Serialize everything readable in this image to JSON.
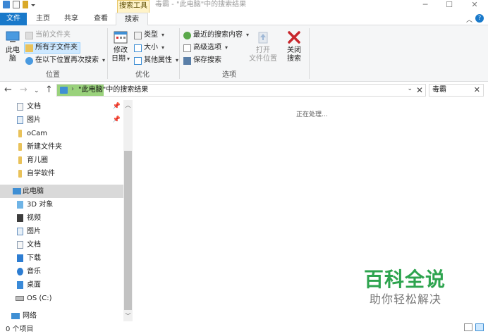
{
  "window": {
    "title": "毒霸 - \"此电脑\"中的搜索结果",
    "context_tab_group": "搜索工具"
  },
  "tabs": [
    {
      "label": "文件"
    },
    {
      "label": "主页"
    },
    {
      "label": "共享"
    },
    {
      "label": "查看"
    },
    {
      "label": "搜索"
    }
  ],
  "ribbon": {
    "location": {
      "label": "位置",
      "this_pc": "此电\n脑",
      "current_folder": "当前文件夹",
      "all_subfolders": "所有子文件夹",
      "search_again_in": "在以下位置再次搜索"
    },
    "refine": {
      "label": "优化",
      "date_modified": "修改\n日期",
      "kind": "类型",
      "size": "大小",
      "other_properties": "其他属性"
    },
    "options": {
      "label": "选项",
      "recent_searches": "最近的搜索内容",
      "advanced_options": "高级选项",
      "save_search": "保存搜索",
      "open_file_location": "打开\n文件位置",
      "close_search": "关闭\n搜索"
    }
  },
  "address": {
    "path_text": "\"此电脑\"中的搜索结果",
    "search_value": "毒霸"
  },
  "nav": {
    "items": [
      {
        "label": "文档",
        "icon": "document-icon",
        "pinned": true
      },
      {
        "label": "图片",
        "icon": "pictures-icon",
        "pinned": true
      },
      {
        "label": "oCam",
        "icon": "folder-icon"
      },
      {
        "label": "新建文件夹",
        "icon": "folder-icon"
      },
      {
        "label": "育儿圈",
        "icon": "folder-icon"
      },
      {
        "label": "自学软件",
        "icon": "folder-icon"
      },
      {
        "label": "此电脑",
        "icon": "this-pc-icon",
        "selected": true
      },
      {
        "label": "3D 对象",
        "icon": "3d-objects-icon"
      },
      {
        "label": "视频",
        "icon": "videos-icon"
      },
      {
        "label": "图片",
        "icon": "pictures-icon"
      },
      {
        "label": "文档",
        "icon": "document-icon"
      },
      {
        "label": "下载",
        "icon": "downloads-icon"
      },
      {
        "label": "音乐",
        "icon": "music-icon"
      },
      {
        "label": "桌面",
        "icon": "desktop-icon"
      },
      {
        "label": "OS (C:)",
        "icon": "drive-icon"
      },
      {
        "label": "网络",
        "icon": "network-icon"
      }
    ]
  },
  "content": {
    "status_message": "正在处理..."
  },
  "watermark": {
    "main": "百科全说",
    "sub": "助你轻松解决"
  },
  "statusbar": {
    "item_count": "0 个项目"
  },
  "colors": {
    "accent": "#1979ca",
    "context_tab": "#fff3c8",
    "address_highlight": "#9ad27c",
    "watermark_green": "#2ea44f"
  }
}
